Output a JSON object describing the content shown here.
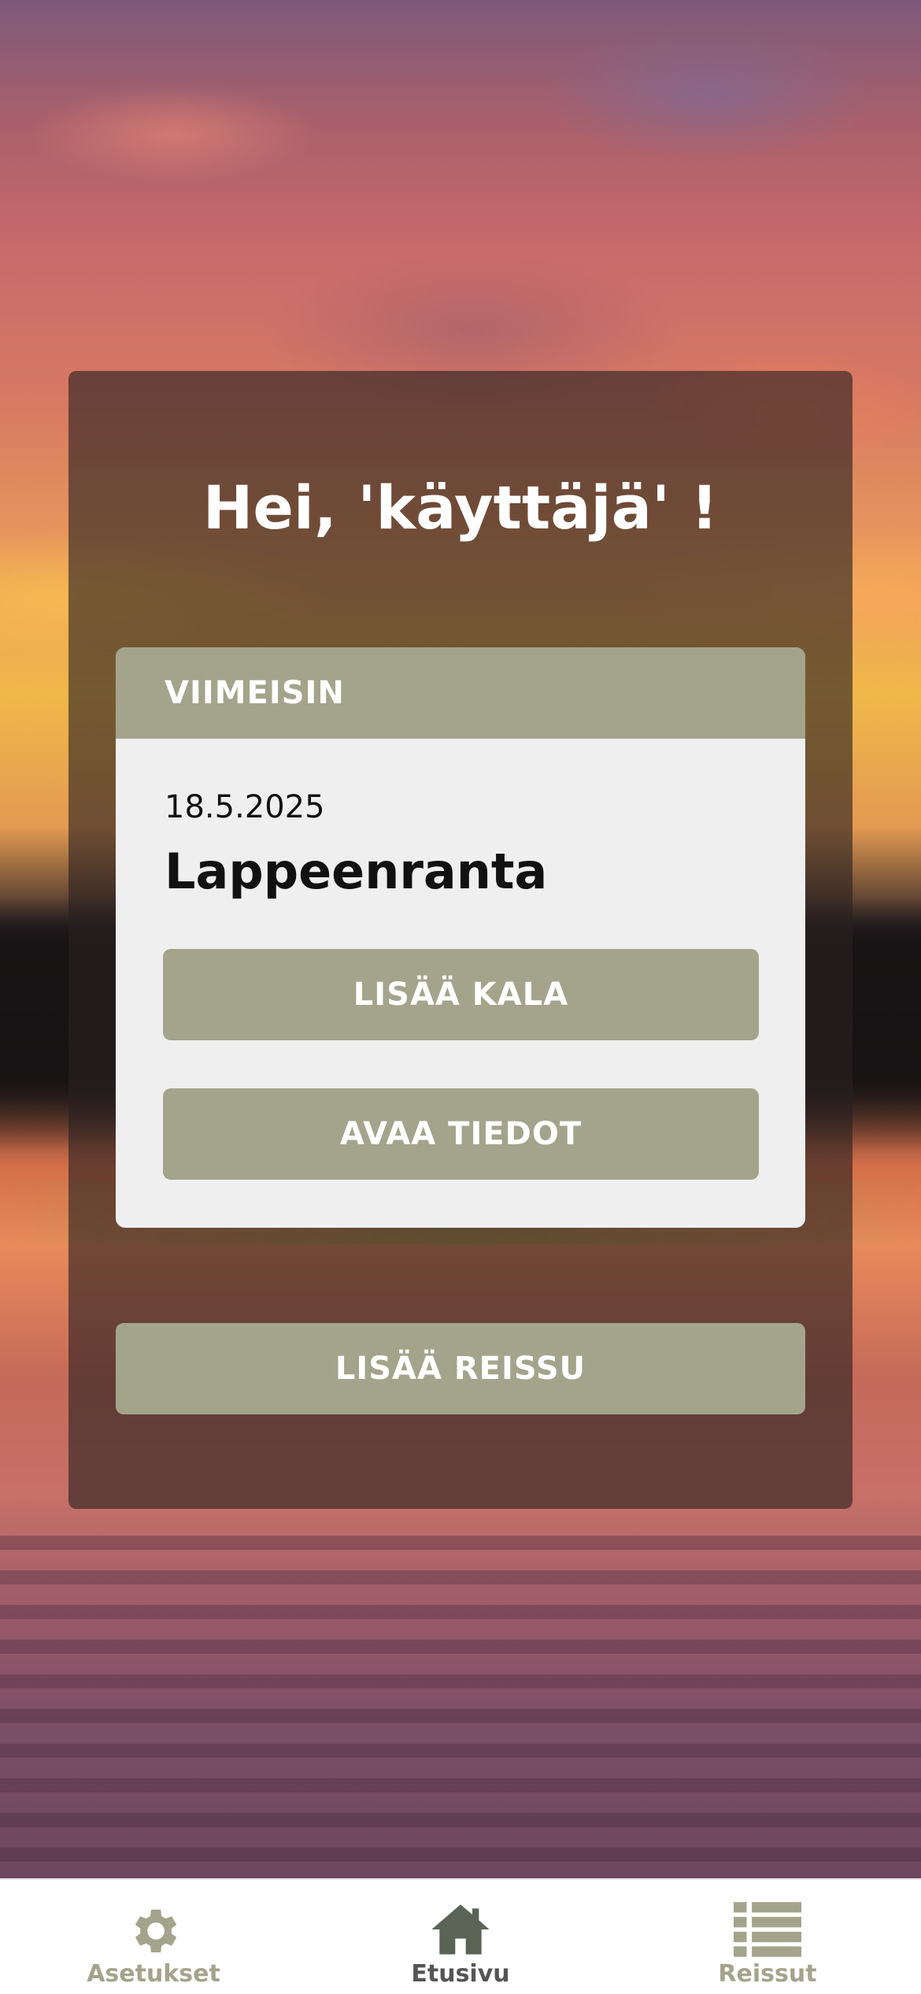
{
  "greeting": "Hei, 'käyttäjä' !",
  "latest_card": {
    "header": "VIIMEISIN",
    "date": "18.5.2025",
    "place": "Lappeenranta",
    "add_fish_label": "LISÄÄ KALA",
    "open_details_label": "AVAA TIEDOT"
  },
  "add_trip_label": "LISÄÄ REISSU",
  "nav": {
    "items": [
      {
        "label": "Asetukset",
        "icon": "gear-icon",
        "active": false
      },
      {
        "label": "Etusivu",
        "icon": "home-icon",
        "active": true
      },
      {
        "label": "Reissut",
        "icon": "list-icon",
        "active": false
      }
    ]
  },
  "colors": {
    "accent": "#a3a48b",
    "card_bg": "#efefef",
    "nav_active": "#555555"
  }
}
